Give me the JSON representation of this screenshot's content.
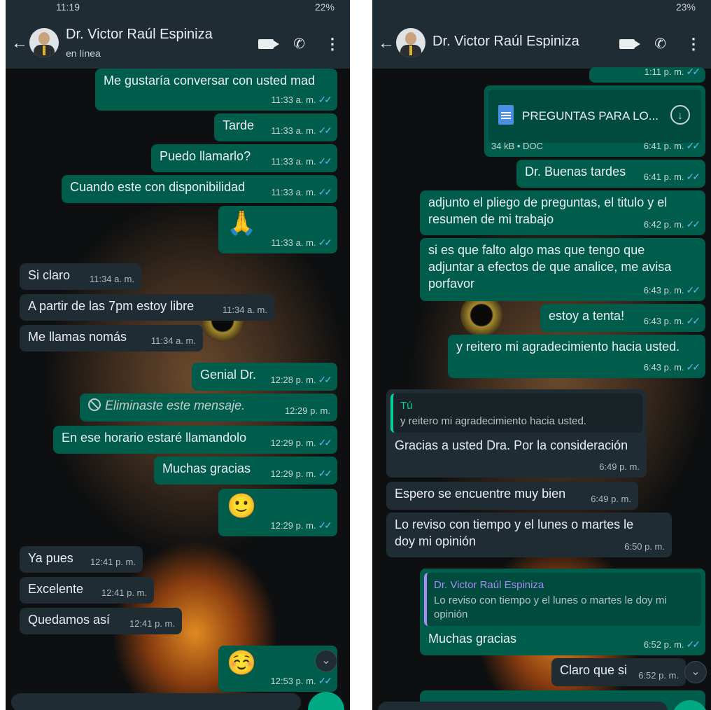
{
  "left": {
    "status_time": "11:19",
    "status_right": "22%",
    "contact_name": "Dr. Victor Raúl Espiniza",
    "contact_status": "en línea",
    "messages": [
      {
        "text": "Me gustaría conversar con usted mad",
        "time": "11:33 a. m."
      },
      {
        "text": "Tarde",
        "time": "11:33 a. m."
      },
      {
        "text": "Puedo llamarlo?",
        "time": "11:33 a. m."
      },
      {
        "text": "Cuando este con disponibilidad",
        "time": "11:33 a. m."
      },
      {
        "text": "🙏",
        "time": "11:33 a. m."
      },
      {
        "text": "Si claro",
        "time": "11:34 a. m."
      },
      {
        "text": "A partir de las 7pm estoy libre",
        "time": "11:34 a. m."
      },
      {
        "text": "Me llamas nomás",
        "time": "11:34 a. m."
      },
      {
        "text": "Genial Dr.",
        "time": "12:28 p. m."
      },
      {
        "text": "Eliminaste este mensaje.",
        "time": "12:29 p. m."
      },
      {
        "text": "En ese horario estaré llamandolo",
        "time": "12:29 p. m."
      },
      {
        "text": "Muchas gracias",
        "time": "12:29 p. m."
      },
      {
        "text": "🙂",
        "time": "12:29 p. m."
      },
      {
        "text": "Ya pues",
        "time": "12:41 p. m."
      },
      {
        "text": "Excelente",
        "time": "12:41 p. m."
      },
      {
        "text": "Quedamos así",
        "time": "12:41 p. m."
      },
      {
        "text": "☺️",
        "time": "12:53 p. m."
      }
    ]
  },
  "right": {
    "status_right": "23%",
    "contact_name": "Dr. Victor Raúl Espiniza",
    "top_partial_time": "1:11 p. m.",
    "doc": {
      "name": "PREGUNTAS PARA LO...",
      "meta": "34 kB • DOC",
      "time": "6:41 p. m."
    },
    "messages": [
      {
        "text": "Dr. Buenas tardes",
        "time": "6:41 p. m."
      },
      {
        "text": "adjunto el pliego de preguntas, el titulo y el resumen de mi trabajo",
        "time": "6:42 p. m."
      },
      {
        "text": "si es que falto algo mas que tengo que adjuntar a efectos de que analice, me avisa porfavor",
        "time": "6:43 p. m."
      },
      {
        "text": "estoy a tenta!",
        "time": "6:43 p. m."
      },
      {
        "text": "y reitero mi agradecimiento hacia usted.",
        "time": "6:43 p. m."
      }
    ],
    "reply1": {
      "author": "Tú",
      "quoted": "y reitero mi agradecimiento hacia usted.",
      "text": "Gracias a usted Dra. Por la consideración",
      "time": "6:49 p. m."
    },
    "in2": {
      "text": "Espero se encuentre muy bien",
      "time": "6:49 p. m."
    },
    "in3": {
      "text": "Lo reviso con tiempo y el lunes o martes le doy mi opinión",
      "time": "6:50 p. m."
    },
    "reply2": {
      "author": "Dr. Victor Raúl Espiniza",
      "quoted": "Lo reviso con tiempo y el lunes o martes le doy mi opinión",
      "text": "Muchas gracias",
      "time": "6:52 p. m."
    },
    "in4": {
      "text": "Claro que si",
      "time": "6:52 p. m."
    }
  }
}
